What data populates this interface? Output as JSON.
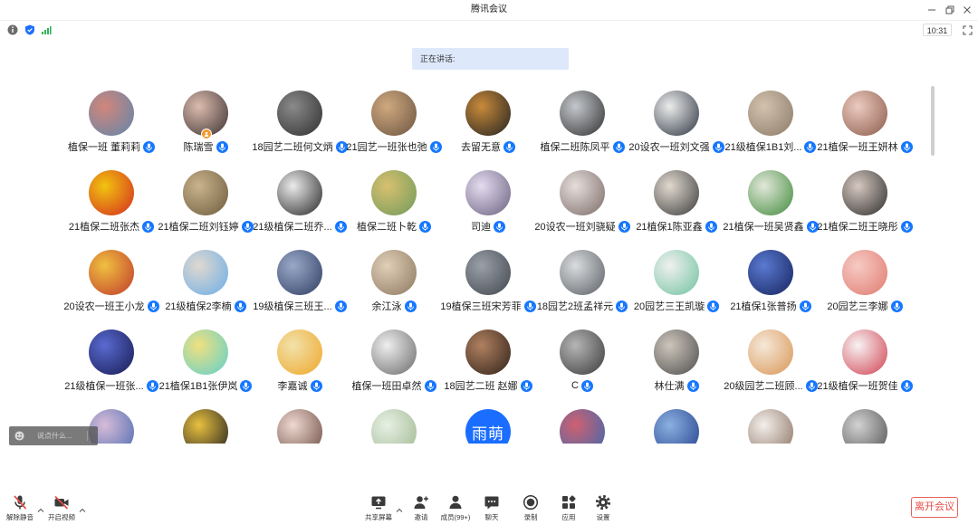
{
  "window": {
    "title": "腾讯会议"
  },
  "status_bar": {
    "time": "10:31"
  },
  "speaking": {
    "label": "正在讲话:"
  },
  "chat_input": {
    "placeholder": "说点什么..."
  },
  "colors": {
    "accent": "#1677ff",
    "danger": "#e34d46",
    "speaking_bg": "#dde9fb",
    "signal": "#2fb35a"
  },
  "icons": {
    "window": [
      "minimize-icon",
      "restore-icon",
      "close-icon"
    ],
    "status": [
      "info-icon",
      "shield-icon",
      "signal-icon",
      "fullscreen-icon"
    ],
    "participant_mic": "mic-on-icon"
  },
  "participants": [
    {
      "name": "植保一班 董莉莉",
      "avatar_colors": [
        "#d2867a",
        "#5f86ad"
      ]
    },
    {
      "name": "陈瑞雪",
      "avatar_colors": [
        "#dcbcae",
        "#3a3030"
      ],
      "host": true
    },
    {
      "name": "18园艺二班何文炳",
      "avatar_colors": [
        "#8a8a8a",
        "#2f2f2f"
      ]
    },
    {
      "name": "21园艺一班张也弛",
      "avatar_colors": [
        "#cfa97f",
        "#6b5440"
      ]
    },
    {
      "name": "去留无意",
      "avatar_colors": [
        "#c88a3a",
        "#222222"
      ]
    },
    {
      "name": "植保二班陈凤平",
      "avatar_colors": [
        "#c4c7cc",
        "#303030"
      ]
    },
    {
      "name": "20设农一班刘文强",
      "avatar_colors": [
        "#ececec",
        "#2c3440"
      ]
    },
    {
      "name": "21级植保1B1刘...",
      "avatar_colors": [
        "#d2c2ae",
        "#8c7a68"
      ]
    },
    {
      "name": "21植保一班王妍林",
      "avatar_colors": [
        "#eccabf",
        "#8a5a4a"
      ]
    },
    {
      "name": "21植保二班张杰",
      "avatar_colors": [
        "#f1c40f",
        "#d42a20"
      ]
    },
    {
      "name": "21植保二班刘钰婷",
      "avatar_colors": [
        "#c9b38d",
        "#6d5b3c"
      ]
    },
    {
      "name": "21级植保二班乔...",
      "avatar_colors": [
        "#ebebeb",
        "#252525"
      ]
    },
    {
      "name": "植保二班卜乾",
      "avatar_colors": [
        "#d8c070",
        "#6f9a5a"
      ]
    },
    {
      "name": "司迪",
      "avatar_colors": [
        "#e4dcef",
        "#6a6080"
      ]
    },
    {
      "name": "20设农一班刘骁疑",
      "avatar_colors": [
        "#e6dedc",
        "#7a6a66"
      ]
    },
    {
      "name": "21植保1陈亚鑫",
      "avatar_colors": [
        "#e0d9cf",
        "#3a3a3a"
      ]
    },
    {
      "name": "21植保一班吴贤鑫",
      "avatar_colors": [
        "#e2e8da",
        "#3f8a3a"
      ]
    },
    {
      "name": "21植保二班王晓彤",
      "avatar_colors": [
        "#d6c8c0",
        "#2c2c2c"
      ]
    },
    {
      "name": "20设农一班王小龙",
      "avatar_colors": [
        "#f0c040",
        "#c0392b"
      ]
    },
    {
      "name": "21级植保2李楠",
      "avatar_colors": [
        "#e0d8d0",
        "#6aaee6"
      ]
    },
    {
      "name": "19级植保三班王...",
      "avatar_colors": [
        "#9aa8c8",
        "#2f3d63"
      ]
    },
    {
      "name": "余江泳",
      "avatar_colors": [
        "#e0d0b8",
        "#8d765e"
      ]
    },
    {
      "name": "19植保三班宋芳菲",
      "avatar_colors": [
        "#9aa0a8",
        "#41464d"
      ]
    },
    {
      "name": "18园艺2班孟祥元",
      "avatar_colors": [
        "#dadcde",
        "#5a5f64"
      ]
    },
    {
      "name": "20园艺三王凯璇",
      "avatar_colors": [
        "#f0f0f0",
        "#6fc29f"
      ]
    },
    {
      "name": "21植保1张普扬",
      "avatar_colors": [
        "#5a7ad0",
        "#16225e"
      ]
    },
    {
      "name": "20园艺三李娜",
      "avatar_colors": [
        "#f6cbc4",
        "#e07a70"
      ]
    },
    {
      "name": "21级植保一班张...",
      "avatar_colors": [
        "#5a6ad0",
        "#161b52"
      ]
    },
    {
      "name": "21植保1B1张伊岚",
      "avatar_colors": [
        "#f0e080",
        "#5fd0cc"
      ]
    },
    {
      "name": "李嘉诚",
      "avatar_colors": [
        "#f2e2aa",
        "#eea62a"
      ]
    },
    {
      "name": "植保一班田卓然",
      "avatar_colors": [
        "#eeeeee",
        "#6a6a6a"
      ]
    },
    {
      "name": "18园艺二班 赵娜",
      "avatar_colors": [
        "#b08060",
        "#2f2219"
      ]
    },
    {
      "name": "C",
      "avatar_colors": [
        "#b5b5b5",
        "#3a3a3a"
      ]
    },
    {
      "name": "林仕满",
      "avatar_colors": [
        "#cdc5bb",
        "#4d4d4d"
      ]
    },
    {
      "name": "20级园艺二班顾...",
      "avatar_colors": [
        "#f5e8d8",
        "#d99555"
      ]
    },
    {
      "name": "21级植保一班贺佳",
      "avatar_colors": [
        "#f7f3f3",
        "#d04050"
      ]
    },
    {
      "avatar_colors": [
        "#d8bcd8",
        "#4a6ab0"
      ]
    },
    {
      "avatar_colors": [
        "#e8c040",
        "#1e1e1e"
      ]
    },
    {
      "avatar_colors": [
        "#efd9d1",
        "#6a4a40"
      ]
    },
    {
      "avatar_colors": [
        "#e6f0e4",
        "#a0b890"
      ]
    },
    {
      "avatar_text": "雨萌",
      "avatar_colors": [
        "#1a6dff",
        "#1a6dff"
      ]
    },
    {
      "avatar_colors": [
        "#d06070",
        "#3a6ab0"
      ]
    },
    {
      "avatar_colors": [
        "#8ab0e0",
        "#23408c"
      ]
    },
    {
      "avatar_colors": [
        "#f3efeb",
        "#8a7060"
      ]
    },
    {
      "avatar_colors": [
        "#d2d2d2",
        "#505050"
      ]
    }
  ],
  "toolbar": {
    "unmute_label": "解除静音",
    "video_label": "开启视频",
    "share_label": "共享屏幕",
    "invite_label": "邀请",
    "members_label": "成员(99+)",
    "chat_label": "聊天",
    "record_label": "录制",
    "apps_label": "应用",
    "settings_label": "设置",
    "leave_label": "离开会议"
  }
}
